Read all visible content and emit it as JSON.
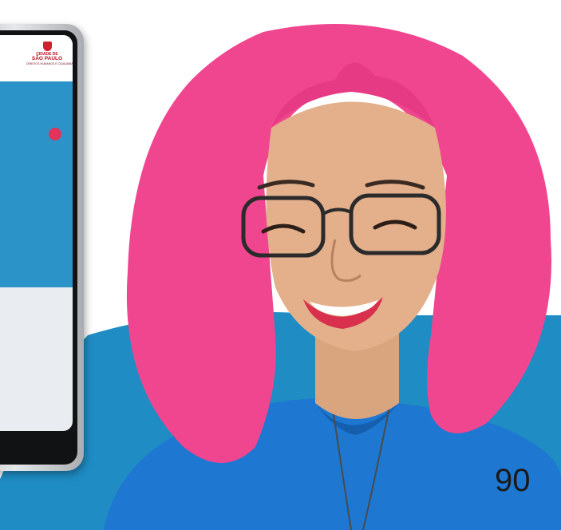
{
  "phone_screen": {
    "logo": {
      "line1": "CIDADE DE",
      "line2": "SÃO PAULO",
      "line3": "DIREITOS HUMANOS E CIDADANIA"
    }
  },
  "page": {
    "number": "90"
  },
  "colors": {
    "brand_blue": "#1f8cc4",
    "hair_pink": "#f0468f",
    "shirt_blue": "#1e78d2",
    "logo_red": "#c8192a"
  }
}
